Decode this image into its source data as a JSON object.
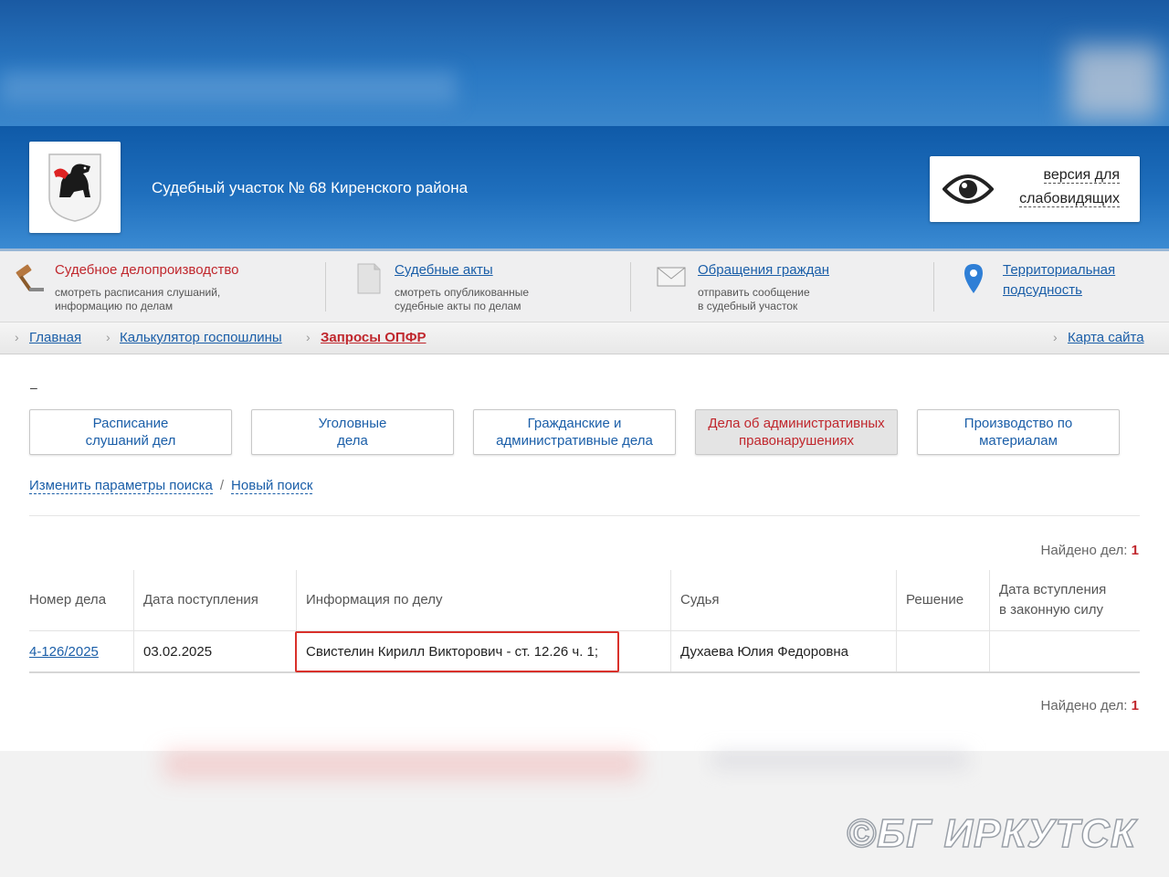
{
  "site": {
    "title": "Судебный участок № 68 Киренского района"
  },
  "vision_btn": {
    "line1": "версия для",
    "line2": "слабовидящих"
  },
  "services": [
    {
      "title": "Судебное делопроизводство",
      "desc1": "смотреть расписания слушаний,",
      "desc2": "информацию по делам",
      "icon": "gavel-icon"
    },
    {
      "title": "Судебные акты",
      "desc1": "смотреть опубликованные",
      "desc2": "судебные акты по делам",
      "icon": "document-icon"
    },
    {
      "title": "Обращения граждан",
      "desc1": "отправить сообщение",
      "desc2": "в судебный участок",
      "icon": "envelope-icon"
    },
    {
      "title": "Территориальная",
      "title2": "подсудность",
      "icon": "map-pin-icon"
    }
  ],
  "breadcrumb": {
    "home": "Главная",
    "calc": "Калькулятор госпошлины",
    "current": "Запросы ОПФР",
    "sitemap": "Карта сайта"
  },
  "dash": "–",
  "tabs": [
    {
      "line1": "Расписание",
      "line2": "слушаний дел"
    },
    {
      "line1": "Уголовные",
      "line2": "дела"
    },
    {
      "line1": "Гражданские и",
      "line2": "административные дела"
    },
    {
      "line1": "Дела об административных",
      "line2": "правонарушениях"
    },
    {
      "line1": "Производство по",
      "line2": "материалам"
    }
  ],
  "search": {
    "change": "Изменить параметры поиска",
    "sep": "/",
    "new": "Новый поиск"
  },
  "found": {
    "label": "Найдено дел:",
    "count": "1"
  },
  "table": {
    "headers": {
      "number": "Номер дела",
      "date": "Дата поступления",
      "info": "Информация по делу",
      "judge": "Судья",
      "decision": "Решение",
      "force1": "Дата вступления",
      "force2": "в законную силу"
    },
    "rows": [
      {
        "number": "4-126/2025",
        "date": "03.02.2025",
        "info": "Свистелин Кирилл Викторович - ст. 12.26 ч. 1;",
        "judge": "Духаева Юлия Федоровна",
        "decision": "",
        "force": ""
      }
    ]
  },
  "watermark": "©БГ ИРКУТСК",
  "colors": {
    "accent_red": "#c0272d",
    "link_blue": "#1a5ea8",
    "header_blue": "#1f6fbd",
    "highlight": "#d9312b"
  }
}
